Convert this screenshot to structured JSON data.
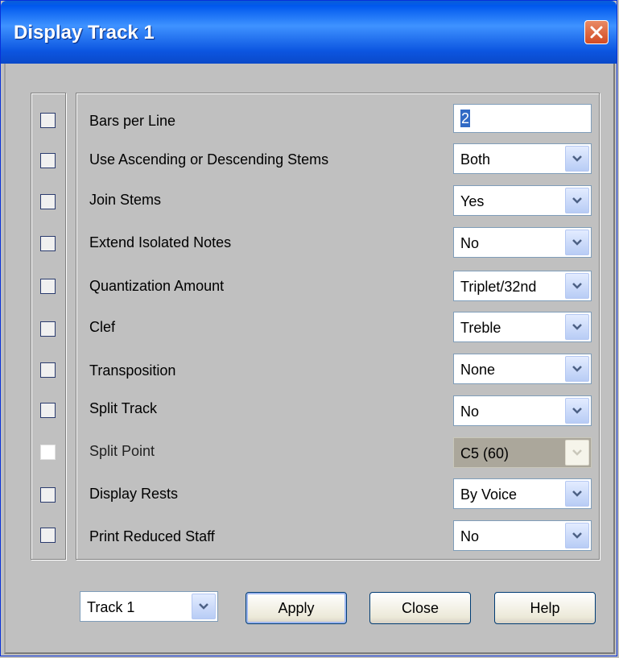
{
  "window": {
    "title": "Display Track 1"
  },
  "rows": [
    {
      "label": "Bars per Line",
      "value": "2",
      "control": "text"
    },
    {
      "label": "Use Ascending or Descending Stems",
      "value": "Both",
      "control": "select"
    },
    {
      "label": "Join Stems",
      "value": "Yes",
      "control": "select"
    },
    {
      "label": "Extend Isolated Notes",
      "value": "No",
      "control": "select"
    },
    {
      "label": "Quantization Amount",
      "value": "Triplet/32nd",
      "control": "select"
    },
    {
      "label": "Clef",
      "value": "Treble",
      "control": "select"
    },
    {
      "label": "Transposition",
      "value": "None",
      "control": "select"
    },
    {
      "label": "Split Track",
      "value": "No",
      "control": "select"
    },
    {
      "label": "Split Point",
      "value": "C5 (60)",
      "control": "select-disabled"
    },
    {
      "label": "Display Rests",
      "value": "By Voice",
      "control": "select"
    },
    {
      "label": "Print Reduced Staff",
      "value": "No",
      "control": "select"
    }
  ],
  "footer": {
    "track_select": "Track 1",
    "apply_label": "Apply",
    "close_label": "Close",
    "help_label": "Help"
  },
  "colors": {
    "titlebar": "#0058ee",
    "close_button": "#d24b24",
    "dialog_bg": "#c0c0c0",
    "combo_arrow": "#4d6185"
  }
}
